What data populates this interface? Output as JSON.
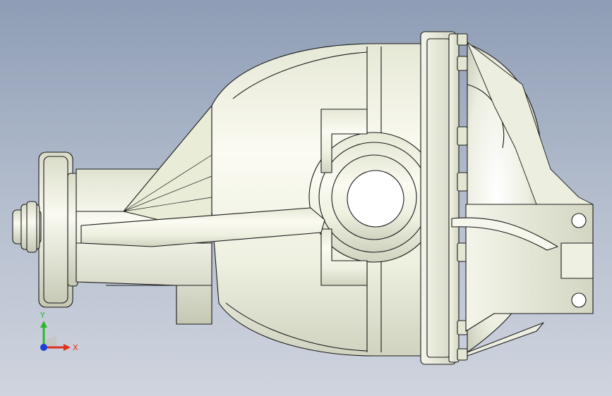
{
  "viewport": {
    "background_top": "#8e9db5",
    "background_bottom": "#cfd4de"
  },
  "model": {
    "description_icon": "differential-housing-model",
    "body_color": "#f2f3e6",
    "shade_color": "#c9cdb8",
    "edge_color": "#1a1a1a"
  },
  "triad": {
    "x_label": "X",
    "y_label": "Y",
    "x_color": "#e0301e",
    "y_color": "#2fb62f",
    "z_color": "#1b3fd8"
  }
}
